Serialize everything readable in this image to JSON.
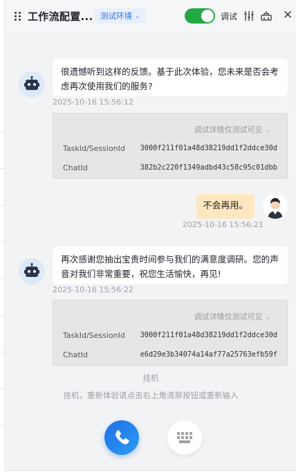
{
  "header": {
    "title": "工作流配置...",
    "env_label": "测试环境",
    "debug_label": "调试",
    "toggle_on": true
  },
  "messages": [
    {
      "role": "bot",
      "text": "很遗憾听到这样的反馈。基于此次体验，您未来是否会考虑再次使用我们的服务?",
      "timestamp": "2025-10-16 15:56:12",
      "debug": {
        "title": "调试详情仅测试可见",
        "task_label": "TaskId/SessionId",
        "task_value": "3000f211f01a48d38219dd1f2ddce30d",
        "chat_label": "ChatId",
        "chat_value": "382b2c220f1349adbd43c58c95c01dbb"
      }
    },
    {
      "role": "user",
      "text": "不会再用。",
      "timestamp": "2025-10-16 15:56:21"
    },
    {
      "role": "bot",
      "text": "再次感谢您抽出宝贵时间参与我们的满意度调研。您的声音对我们非常重要，祝您生活愉快，再见!",
      "timestamp": "2025-10-16 15:56:22",
      "debug": {
        "title": "调试详情仅测试可见",
        "task_label": "TaskId/SessionId",
        "task_value": "3000f211f01a48d38219dd1f2ddce30d",
        "chat_label": "ChatId",
        "chat_value": "e6d29e3b34074a14af77a25763efb59f"
      }
    }
  ],
  "system": {
    "hangup": "挂机",
    "hint": "挂机，重新体验请点击右上角清屏按钮或重新输入"
  },
  "colors": {
    "accent": "#2f6fe4",
    "toggle": "#23a845",
    "user_bubble": "#ffe7bf",
    "call_button": "#1f6fe5"
  },
  "icons": {
    "drag": "drag-handle-icon",
    "equalizer": "equalizer-icon",
    "clear": "clear-screen-icon",
    "close": "close-icon",
    "bot": "robot-icon",
    "phone": "phone-icon",
    "keypad": "keypad-icon"
  }
}
